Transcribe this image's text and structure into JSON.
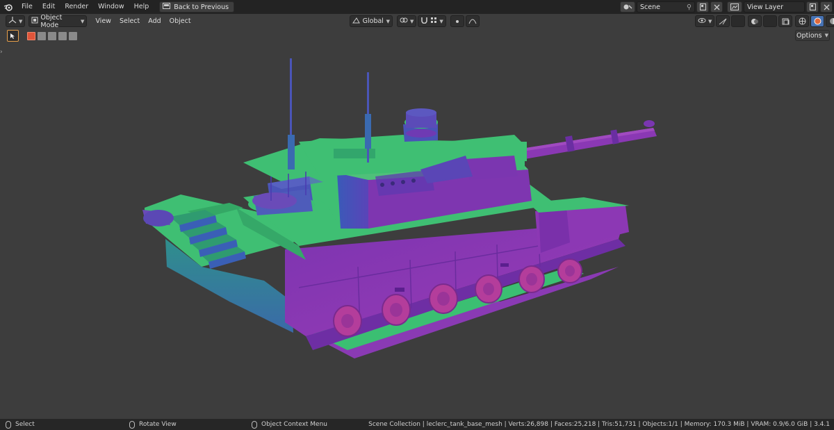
{
  "topbar": {
    "menus": [
      "File",
      "Edit",
      "Render",
      "Window",
      "Help"
    ],
    "back_button": "Back to Previous",
    "scene_name": "Scene",
    "view_layer": "View Layer"
  },
  "viewport_header": {
    "mode": "Object Mode",
    "menus": [
      "View",
      "Select",
      "Add",
      "Object"
    ],
    "orientation": "Global",
    "options": "Options"
  },
  "statusbar": {
    "select": "Select",
    "rotate": "Rotate View",
    "context": "Object Context Menu",
    "stats": "Scene Collection | leclerc_tank_base_mesh | Verts:26,898 | Faces:25,218 | Tris:51,731 | Objects:1/1 | Memory: 170.3 MiB | VRAM: 0.9/6.0 GiB | 3.4.1"
  },
  "colors": {
    "green": "#3fbf73",
    "purple": "#8a3ab8",
    "blue": "#4a55b8",
    "active_shading": "#e06a3c"
  }
}
